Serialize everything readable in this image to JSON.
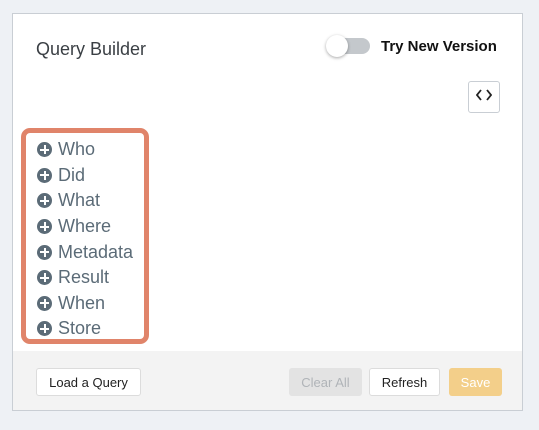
{
  "header": {
    "title": "Query Builder",
    "toggle_label": "Try New Version",
    "toggle_on": false
  },
  "code_button": {
    "icon": "code-icon"
  },
  "fields": [
    {
      "label": "Who"
    },
    {
      "label": "Did"
    },
    {
      "label": "What"
    },
    {
      "label": "Where"
    },
    {
      "label": "Metadata"
    },
    {
      "label": "Result"
    },
    {
      "label": "When"
    },
    {
      "label": "Store"
    }
  ],
  "footer": {
    "load_label": "Load a Query",
    "clear_label": "Clear All",
    "refresh_label": "Refresh",
    "save_label": "Save"
  },
  "colors": {
    "highlight": "#e0846a",
    "field_text": "#5b6b77",
    "save": "#f3cf8a"
  }
}
